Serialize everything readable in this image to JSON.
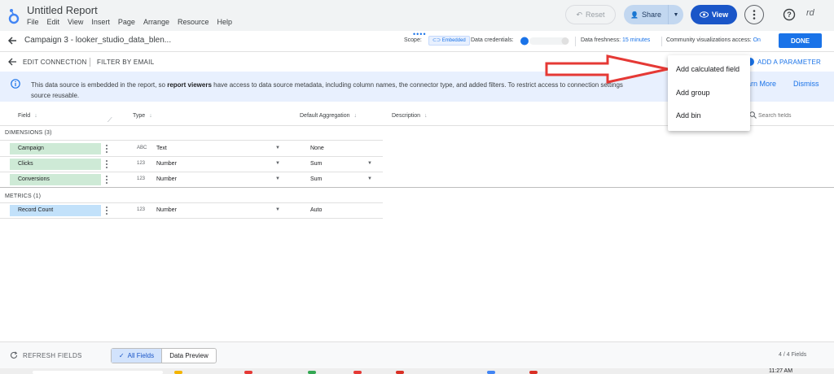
{
  "app": {
    "title": "Untitled Report",
    "menu": [
      "File",
      "Edit",
      "View",
      "Insert",
      "Page",
      "Arrange",
      "Resource",
      "Help"
    ],
    "reset_label": "Reset",
    "share_label": "Share",
    "view_label": "View",
    "user_initials": "rd"
  },
  "datasource_bar": {
    "title": "Campaign 3 - looker_studio_data_blen...",
    "scope_label": "Scope:",
    "scope_value": "Embedded",
    "credentials_label": "Data credentials:",
    "freshness_label": "Data freshness:",
    "freshness_value": "15 minutes",
    "community_label": "Community visualizations access:",
    "community_value": "On",
    "done_label": "DONE"
  },
  "edit_bar": {
    "edit_connection": "EDIT CONNECTION",
    "filter_by_email": "FILTER BY EMAIL",
    "add_parameter": "ADD A PARAMETER"
  },
  "banner": {
    "text_pre": "This data source is embedded in the report, so ",
    "text_bold": "report viewers",
    "text_post": " have access to data source metadata, including column names, the connector type, and added filters. To restrict access to connection settings",
    "text_line2": "source reusable.",
    "learn_more": "earn More",
    "dismiss": "Dismiss"
  },
  "table": {
    "headers": {
      "field": "Field",
      "type": "Type",
      "default_aggregation": "Default Aggregation",
      "description": "Description"
    },
    "search_placeholder": "Search fields",
    "dimensions_label": "DIMENSIONS (3)",
    "metrics_label": "METRICS (1)",
    "dimensions": [
      {
        "name": "Campaign",
        "type_glyph": "ABC",
        "type": "Text",
        "aggregation": "None",
        "agg_dropdown": false
      },
      {
        "name": "Clicks",
        "type_glyph": "123",
        "type": "Number",
        "aggregation": "Sum",
        "agg_dropdown": true
      },
      {
        "name": "Conversions",
        "type_glyph": "123",
        "type": "Number",
        "aggregation": "Sum",
        "agg_dropdown": true
      }
    ],
    "metrics": [
      {
        "name": "Record Count",
        "type_glyph": "123",
        "type": "Number",
        "aggregation": "Auto",
        "agg_dropdown": false
      }
    ]
  },
  "dropdown_menu": {
    "items": [
      "Add calculated field",
      "Add group",
      "Add bin"
    ]
  },
  "bottom_bar": {
    "refresh_label": "REFRESH FIELDS",
    "all_fields": "All Fields",
    "data_preview": "Data Preview",
    "field_count": "4 / 4 Fields"
  },
  "taskbar": {
    "clock": "11:27 AM"
  },
  "colors": {
    "accent": "#1a73e8",
    "dimension_chip": "#ceead6",
    "metric_chip": "#c2e1fa",
    "banner_bg": "#e8f0fe",
    "annotation_arrow": "#e53935"
  },
  "icons": {
    "logo": "looker-studio-logo-icon",
    "back": "arrow-left-icon",
    "info": "info-icon",
    "help": "help-circle-icon",
    "search": "search-icon",
    "refresh": "refresh-icon",
    "more": "more-vert-icon"
  }
}
